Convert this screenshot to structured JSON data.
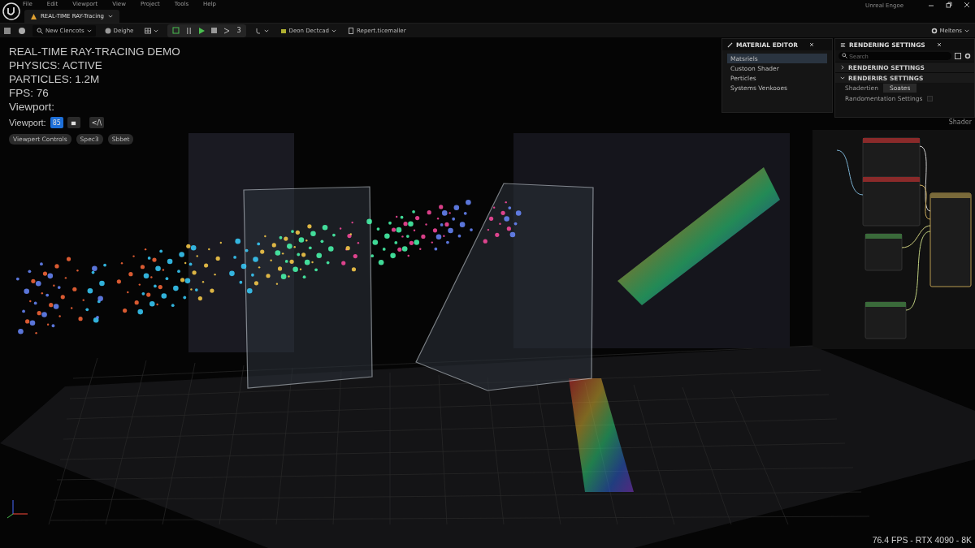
{
  "menu": [
    "File",
    "Edit",
    "Viewport",
    "View",
    "Project",
    "Tools",
    "Help"
  ],
  "window": {
    "app_name": "Unreal Engoe"
  },
  "tabs": [
    {
      "label": "REAL-TIME RAY-Tracing",
      "selected": true
    }
  ],
  "toolbar": {
    "mode_dropdown": "New Clencots",
    "view_label": "Deighe",
    "play_counter": "3",
    "build_dropdown": "Deon Dectcad",
    "report_button": "Repert.ticemaller",
    "settings_dropdown": "Meltens"
  },
  "hud": {
    "lines": [
      "REAL-TIME RAY-TRACING DEMO",
      "PHYSICS: ACTIVE",
      "PARTICLES: 1.2M",
      "FPS: 76",
      "Viewport:"
    ],
    "view_label": "Viewport:",
    "view_buttons": [
      {
        "kind": "text",
        "label": "85",
        "selected": true
      },
      {
        "kind": "icon",
        "selected": false
      },
      {
        "kind": "text",
        "label": "</\\",
        "selected": false
      }
    ],
    "chips": [
      "Viewpert Controls",
      "Spec3",
      "Sbbet"
    ]
  },
  "material_editor": {
    "title": "MATERIAL EDITOR",
    "items": [
      {
        "label": "Matsriels",
        "selected": true
      },
      {
        "label": "Custoon Shader",
        "selected": false
      },
      {
        "label": "Perticles",
        "selected": false
      },
      {
        "label": "Systems Venkooes",
        "selected": false
      }
    ]
  },
  "rendering_settings": {
    "title": "RENDERING SETTINGS",
    "search": {
      "placeholder": "Search"
    },
    "sections": [
      {
        "label": "RENDERINO SETTINGS",
        "expanded": false
      },
      {
        "label": "RENDERIRS SETTINGS",
        "expanded": true
      }
    ],
    "properties": [
      {
        "kind": "value",
        "label": "Shadertien",
        "value": "Soates"
      },
      {
        "kind": "checkbox",
        "label": "Randomentation Settings",
        "checked": false
      }
    ],
    "graph_label": "Shader"
  },
  "status_text": "76.4 FPS - RTX 4090 - 8K"
}
